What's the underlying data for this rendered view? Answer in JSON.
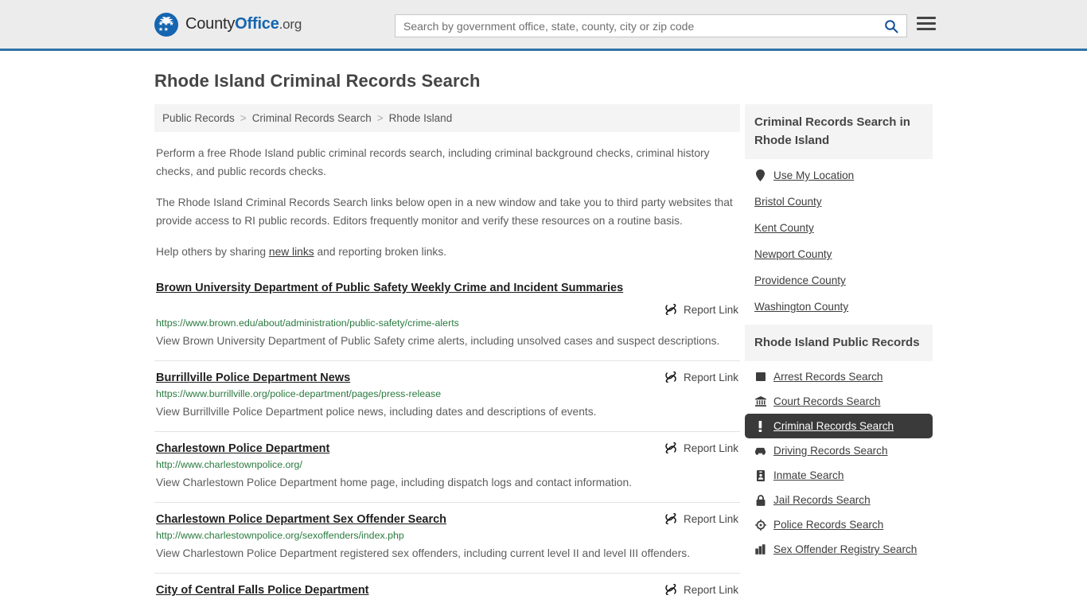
{
  "header": {
    "brand": {
      "part1": "County",
      "part2": "Office",
      "part3": ".org"
    },
    "search": {
      "placeholder": "Search by government office, state, county, city or zip code",
      "value": "",
      "button_label": "search-icon"
    },
    "menu_label": "menu-icon"
  },
  "page": {
    "title": "Rhode Island Criminal Records Search"
  },
  "breadcrumb": {
    "items": [
      {
        "label": "Public Records"
      },
      {
        "label": "Criminal Records Search"
      },
      {
        "label": "Rhode Island"
      }
    ],
    "separator": ">"
  },
  "intro": {
    "p1": "Perform a free Rhode Island public criminal records search, including criminal background checks, criminal history checks, and public records checks.",
    "p2": "The Rhode Island Criminal Records Search links below open in a new window and take you to third party websites that provide access to RI public records. Editors frequently monitor and verify these resources on a routine basis.",
    "p3_before": "Help others by sharing ",
    "p3_link": "new links",
    "p3_after": " and reporting broken links."
  },
  "results": {
    "report_label": "Report Link",
    "items": [
      {
        "title": "Brown University Department of Public Safety Weekly Crime and Incident Summaries",
        "url": "https://www.brown.edu/about/administration/public-safety/crime-alerts",
        "description": "View Brown University Department of Public Safety crime alerts, including unsolved cases and suspect descriptions."
      },
      {
        "title": "Burrillville Police Department News",
        "url": "https://www.burrillville.org/police-department/pages/press-release",
        "description": "View Burrillville Police Department police news, including dates and descriptions of events."
      },
      {
        "title": "Charlestown Police Department",
        "url": "http://www.charlestownpolice.org/",
        "description": "View Charlestown Police Department home page, including dispatch logs and contact information."
      },
      {
        "title": "Charlestown Police Department Sex Offender Search",
        "url": "http://www.charlestownpolice.org/sexoffenders/index.php",
        "description": "View Charlestown Police Department registered sex offenders, including current level II and level III offenders."
      },
      {
        "title": "City of Central Falls Police Department",
        "url": "",
        "description": ""
      }
    ]
  },
  "sidebar": {
    "counties_box": {
      "heading": "Criminal Records Search in Rhode Island",
      "items": [
        {
          "label": "Use My Location",
          "icon": "map-pin-icon",
          "active": false
        },
        {
          "label": "Bristol County",
          "icon": "",
          "active": false
        },
        {
          "label": "Kent County",
          "icon": "",
          "active": false
        },
        {
          "label": "Newport County",
          "icon": "",
          "active": false
        },
        {
          "label": "Providence County",
          "icon": "",
          "active": false
        },
        {
          "label": "Washington County",
          "icon": "",
          "active": false
        }
      ]
    },
    "records_box": {
      "heading": "Rhode Island Public Records",
      "items": [
        {
          "label": "Arrest Records Search",
          "icon": "square-icon",
          "active": false
        },
        {
          "label": "Court Records Search",
          "icon": "courthouse-icon",
          "active": false
        },
        {
          "label": "Criminal Records Search",
          "icon": "exclamation-icon",
          "active": true
        },
        {
          "label": "Driving Records Search",
          "icon": "car-icon",
          "active": false
        },
        {
          "label": "Inmate Search",
          "icon": "id-badge-icon",
          "active": false
        },
        {
          "label": "Jail Records Search",
          "icon": "lock-icon",
          "active": false
        },
        {
          "label": "Police Records Search",
          "icon": "police-badge-icon",
          "active": false
        },
        {
          "label": "Sex Offender Registry Search",
          "icon": "buildings-icon",
          "active": false
        }
      ]
    }
  },
  "colors": {
    "header_bg": "#ececec",
    "header_border": "#3174a8",
    "brand_blue": "#1565b0",
    "url_green": "#2a7a3f",
    "active_bg": "#3a3a3a",
    "panel_bg": "#f4f4f4"
  }
}
